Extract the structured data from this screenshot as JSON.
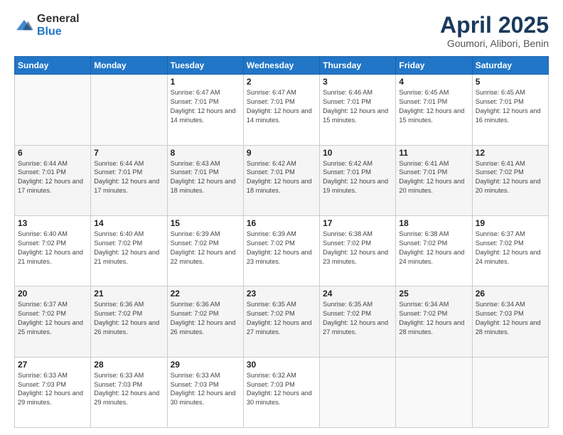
{
  "header": {
    "logo": {
      "general": "General",
      "blue": "Blue"
    },
    "title": "April 2025",
    "location": "Goumori, Alibori, Benin"
  },
  "days_of_week": [
    "Sunday",
    "Monday",
    "Tuesday",
    "Wednesday",
    "Thursday",
    "Friday",
    "Saturday"
  ],
  "weeks": [
    [
      {
        "day": "",
        "info": ""
      },
      {
        "day": "",
        "info": ""
      },
      {
        "day": "1",
        "info": "Sunrise: 6:47 AM\nSunset: 7:01 PM\nDaylight: 12 hours and 14 minutes."
      },
      {
        "day": "2",
        "info": "Sunrise: 6:47 AM\nSunset: 7:01 PM\nDaylight: 12 hours and 14 minutes."
      },
      {
        "day": "3",
        "info": "Sunrise: 6:46 AM\nSunset: 7:01 PM\nDaylight: 12 hours and 15 minutes."
      },
      {
        "day": "4",
        "info": "Sunrise: 6:45 AM\nSunset: 7:01 PM\nDaylight: 12 hours and 15 minutes."
      },
      {
        "day": "5",
        "info": "Sunrise: 6:45 AM\nSunset: 7:01 PM\nDaylight: 12 hours and 16 minutes."
      }
    ],
    [
      {
        "day": "6",
        "info": "Sunrise: 6:44 AM\nSunset: 7:01 PM\nDaylight: 12 hours and 17 minutes."
      },
      {
        "day": "7",
        "info": "Sunrise: 6:44 AM\nSunset: 7:01 PM\nDaylight: 12 hours and 17 minutes."
      },
      {
        "day": "8",
        "info": "Sunrise: 6:43 AM\nSunset: 7:01 PM\nDaylight: 12 hours and 18 minutes."
      },
      {
        "day": "9",
        "info": "Sunrise: 6:42 AM\nSunset: 7:01 PM\nDaylight: 12 hours and 18 minutes."
      },
      {
        "day": "10",
        "info": "Sunrise: 6:42 AM\nSunset: 7:01 PM\nDaylight: 12 hours and 19 minutes."
      },
      {
        "day": "11",
        "info": "Sunrise: 6:41 AM\nSunset: 7:01 PM\nDaylight: 12 hours and 20 minutes."
      },
      {
        "day": "12",
        "info": "Sunrise: 6:41 AM\nSunset: 7:02 PM\nDaylight: 12 hours and 20 minutes."
      }
    ],
    [
      {
        "day": "13",
        "info": "Sunrise: 6:40 AM\nSunset: 7:02 PM\nDaylight: 12 hours and 21 minutes."
      },
      {
        "day": "14",
        "info": "Sunrise: 6:40 AM\nSunset: 7:02 PM\nDaylight: 12 hours and 21 minutes."
      },
      {
        "day": "15",
        "info": "Sunrise: 6:39 AM\nSunset: 7:02 PM\nDaylight: 12 hours and 22 minutes."
      },
      {
        "day": "16",
        "info": "Sunrise: 6:39 AM\nSunset: 7:02 PM\nDaylight: 12 hours and 23 minutes."
      },
      {
        "day": "17",
        "info": "Sunrise: 6:38 AM\nSunset: 7:02 PM\nDaylight: 12 hours and 23 minutes."
      },
      {
        "day": "18",
        "info": "Sunrise: 6:38 AM\nSunset: 7:02 PM\nDaylight: 12 hours and 24 minutes."
      },
      {
        "day": "19",
        "info": "Sunrise: 6:37 AM\nSunset: 7:02 PM\nDaylight: 12 hours and 24 minutes."
      }
    ],
    [
      {
        "day": "20",
        "info": "Sunrise: 6:37 AM\nSunset: 7:02 PM\nDaylight: 12 hours and 25 minutes."
      },
      {
        "day": "21",
        "info": "Sunrise: 6:36 AM\nSunset: 7:02 PM\nDaylight: 12 hours and 26 minutes."
      },
      {
        "day": "22",
        "info": "Sunrise: 6:36 AM\nSunset: 7:02 PM\nDaylight: 12 hours and 26 minutes."
      },
      {
        "day": "23",
        "info": "Sunrise: 6:35 AM\nSunset: 7:02 PM\nDaylight: 12 hours and 27 minutes."
      },
      {
        "day": "24",
        "info": "Sunrise: 6:35 AM\nSunset: 7:02 PM\nDaylight: 12 hours and 27 minutes."
      },
      {
        "day": "25",
        "info": "Sunrise: 6:34 AM\nSunset: 7:02 PM\nDaylight: 12 hours and 28 minutes."
      },
      {
        "day": "26",
        "info": "Sunrise: 6:34 AM\nSunset: 7:03 PM\nDaylight: 12 hours and 28 minutes."
      }
    ],
    [
      {
        "day": "27",
        "info": "Sunrise: 6:33 AM\nSunset: 7:03 PM\nDaylight: 12 hours and 29 minutes."
      },
      {
        "day": "28",
        "info": "Sunrise: 6:33 AM\nSunset: 7:03 PM\nDaylight: 12 hours and 29 minutes."
      },
      {
        "day": "29",
        "info": "Sunrise: 6:33 AM\nSunset: 7:03 PM\nDaylight: 12 hours and 30 minutes."
      },
      {
        "day": "30",
        "info": "Sunrise: 6:32 AM\nSunset: 7:03 PM\nDaylight: 12 hours and 30 minutes."
      },
      {
        "day": "",
        "info": ""
      },
      {
        "day": "",
        "info": ""
      },
      {
        "day": "",
        "info": ""
      }
    ]
  ]
}
